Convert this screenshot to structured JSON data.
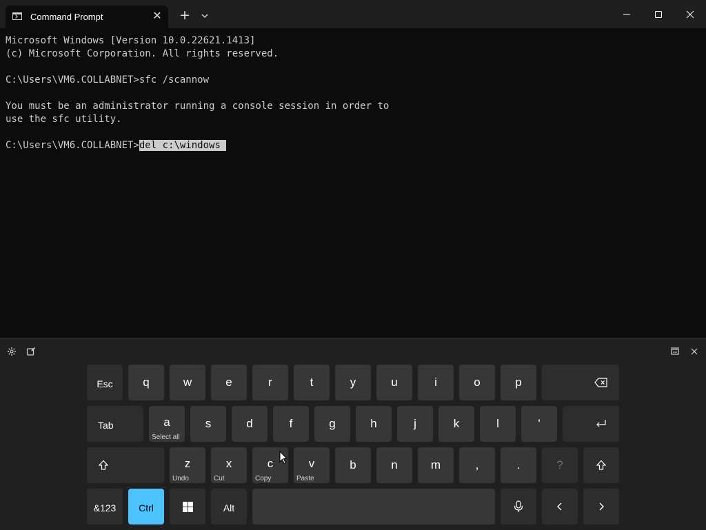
{
  "titlebar": {
    "tab_title": "Command Prompt",
    "tab_close": "✕",
    "new_tab": "+"
  },
  "console": {
    "lines": [
      "Microsoft Windows [Version 10.0.22621.1413]",
      "(c) Microsoft Corporation. All rights reserved.",
      "",
      "C:\\Users\\VM6.COLLABNET>sfc /scannow",
      "",
      "You must be an administrator running a console session in order to",
      "use the sfc utility.",
      ""
    ],
    "prompt": "C:\\Users\\VM6.COLLABNET>",
    "selected_input": "del c:\\windows "
  },
  "keyboard": {
    "row1": {
      "esc": "Esc",
      "keys": [
        "q",
        "w",
        "e",
        "r",
        "t",
        "y",
        "u",
        "i",
        "o",
        "p"
      ]
    },
    "row2": {
      "tab": "Tab",
      "keys": [
        "a",
        "s",
        "d",
        "f",
        "g",
        "h",
        "j",
        "k",
        "l",
        "'"
      ],
      "a_hint": "Select all"
    },
    "row3": {
      "keys": [
        "z",
        "x",
        "c",
        "v",
        "b",
        "n",
        "m",
        ",",
        ".",
        "?"
      ],
      "z_hint": "Undo",
      "x_hint": "Cut",
      "c_hint": "Copy",
      "v_hint": "Paste"
    },
    "row4": {
      "symbols": "&123",
      "ctrl": "Ctrl",
      "alt": "Alt"
    }
  },
  "colors": {
    "console_bg": "#0c0c0c",
    "console_text": "#cccccc",
    "titlebar_bg": "#1f1f1f",
    "keyboard_bg": "#202020",
    "key_bg": "#373737",
    "ctrl_active": "#4cc2ff"
  },
  "icons": {
    "tab": "cmd-icon",
    "dropdown": "chevron-down-icon",
    "minimize": "minimize-icon",
    "maximize": "maximize-icon",
    "close": "close-icon",
    "settings": "gear-icon",
    "handwriting": "handwriting-icon",
    "dock": "dock-icon",
    "kb_close": "close-icon",
    "backspace": "backspace-icon",
    "enter": "enter-icon",
    "shift": "shift-icon",
    "windows": "windows-logo-icon",
    "mic": "microphone-icon",
    "left": "arrow-left-icon",
    "right": "arrow-right-icon"
  }
}
